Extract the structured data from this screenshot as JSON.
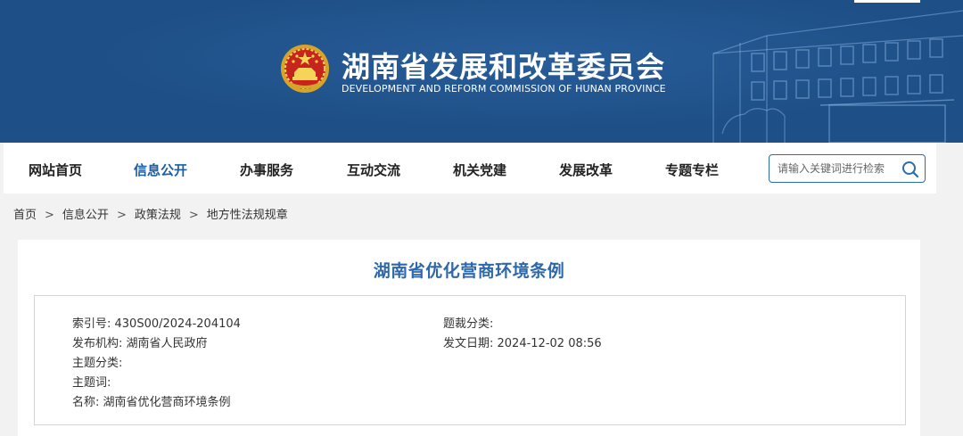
{
  "header": {
    "site_title": "湖南省发展和改革委员会",
    "site_subtitle": "DEVELOPMENT AND REFORM COMMISSION OF HUNAN PROVINCE",
    "emblem_icon": "national-emblem-icon",
    "banner_color": "#1e4f86"
  },
  "nav": {
    "items": [
      {
        "label": "网站首页"
      },
      {
        "label": "信息公开",
        "active": true
      },
      {
        "label": "办事服务"
      },
      {
        "label": "互动交流"
      },
      {
        "label": "机关党建"
      },
      {
        "label": "发展改革"
      },
      {
        "label": "专题专栏"
      }
    ],
    "active_color": "#1a5fa8",
    "search": {
      "placeholder": "请输入关键词进行检索",
      "icon": "search-icon"
    }
  },
  "breadcrumb": [
    "首页",
    "信息公开",
    "政策法规",
    "地方性法规规章"
  ],
  "breadcrumb_separator": ">",
  "document": {
    "title": "湖南省优化营商环境条例",
    "title_color": "#2e68a8",
    "meta": {
      "index_no": "索引号: 430S00/2024-204104",
      "publisher": "发布机构: 湖南省人民政府",
      "topic_category": "主题分类:",
      "keywords": "主题词:",
      "name": "名称: 湖南省优化营商环境条例",
      "genre_category": "题裁分类:",
      "issue_date": "发文日期: 2024-12-02 08:56"
    }
  }
}
